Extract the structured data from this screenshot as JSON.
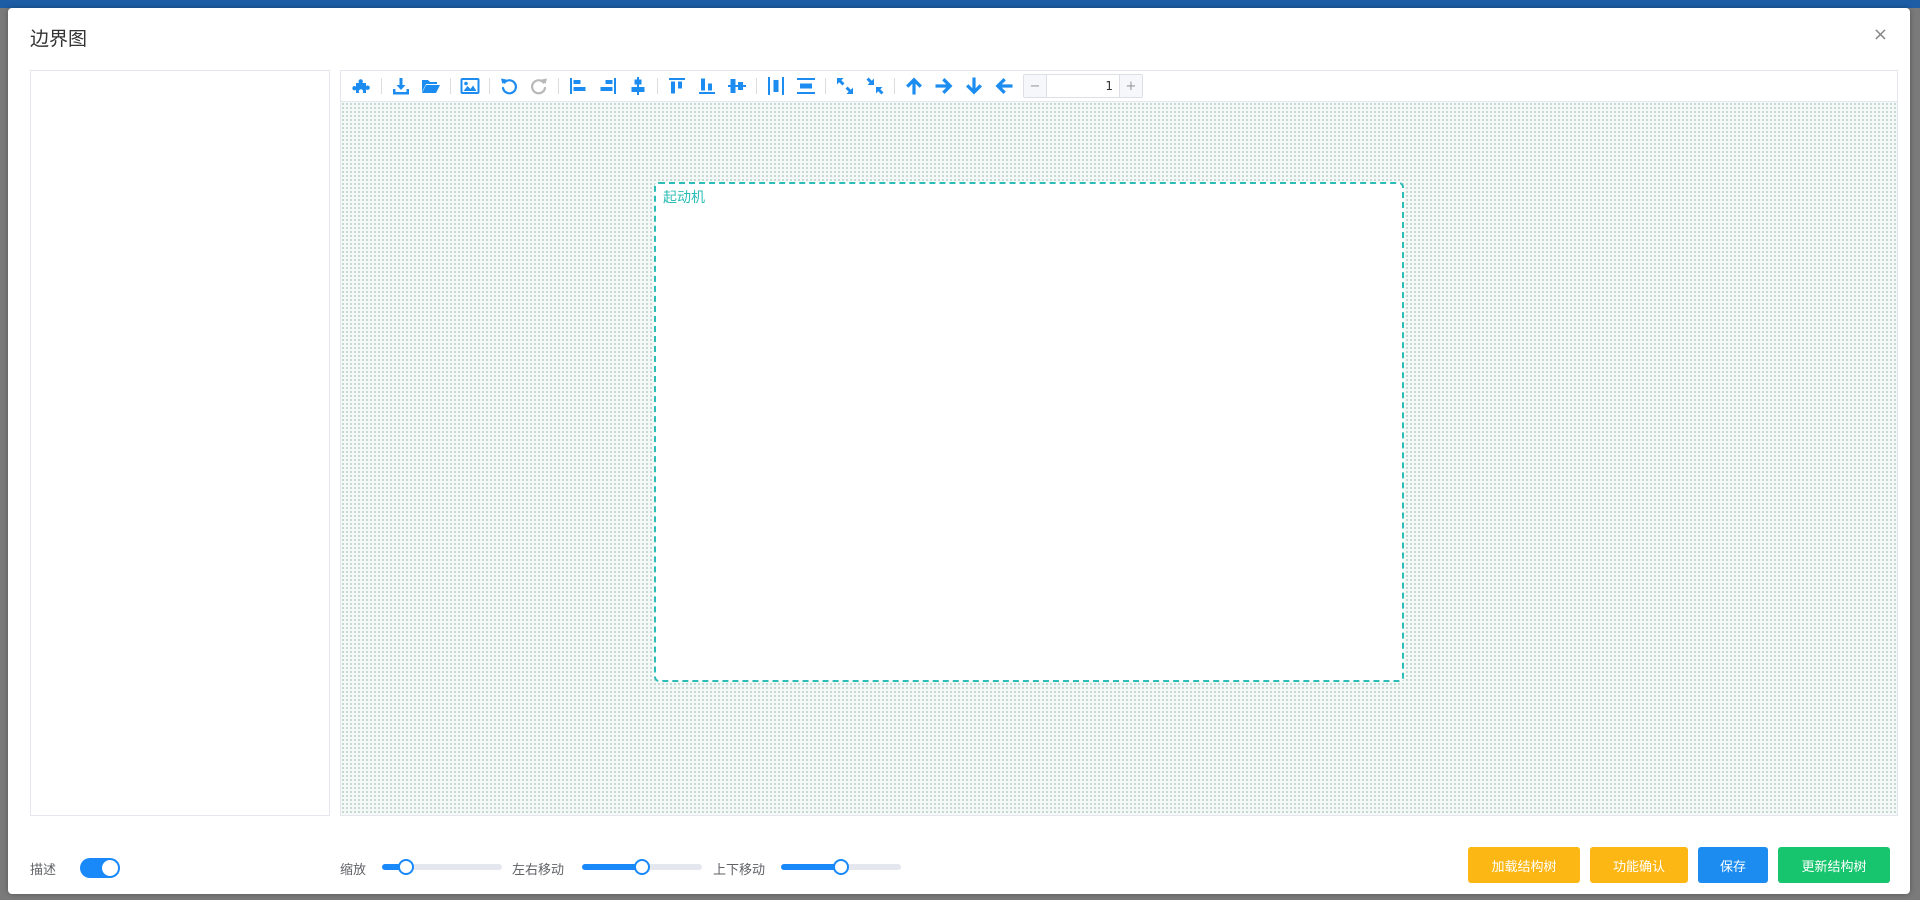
{
  "dialog": {
    "title": "边界图",
    "close_glyph": "×"
  },
  "toolbar": {
    "icons": [
      "puzzle-icon",
      "download-icon",
      "folder-open-icon",
      "image-icon",
      "undo-icon",
      "redo-icon",
      "align-left-icon",
      "align-right-icon",
      "align-center-horizontal-icon",
      "align-top-icon",
      "align-bottom-icon",
      "align-middle-icon",
      "distribute-horizontal-icon",
      "distribute-vertical-icon",
      "expand-icon",
      "compress-icon",
      "arrow-up-icon",
      "arrow-right-icon",
      "arrow-down-icon",
      "arrow-left-icon"
    ],
    "icon_color": "#1c8cf0",
    "zoom_minus": "−",
    "zoom_plus": "+",
    "zoom_value": "1"
  },
  "canvas": {
    "boundary_label": "起动机",
    "boundary_color": "#2bbdb6"
  },
  "footer": {
    "describe_label": "描述",
    "describe_toggle_on": true,
    "zoom_label": "缩放",
    "zoom_level": 0.2,
    "horizontal_label": "左右移动",
    "horizontal_level": 0.5,
    "vertical_label": "上下移动",
    "vertical_level": 0.5,
    "buttons": {
      "load_tree": "加载结构树",
      "confirm_function": "功能确认",
      "save": "保存",
      "update_tree": "更新结构树"
    }
  },
  "colors": {
    "warning": "#fcb714",
    "primary": "#1c8cf0",
    "success": "#17c56e",
    "header_bar": "#1c5da6"
  }
}
